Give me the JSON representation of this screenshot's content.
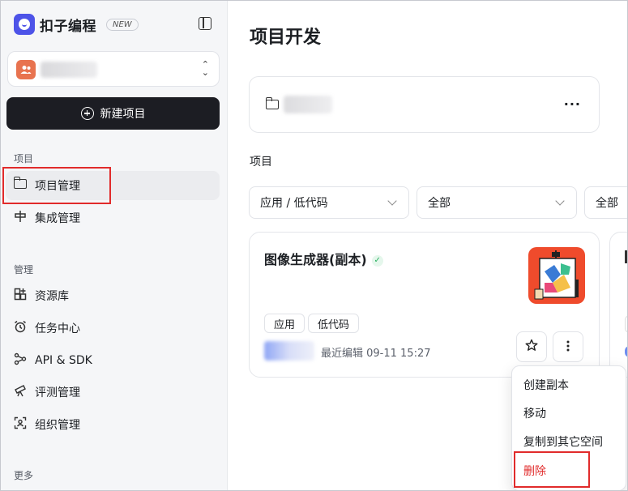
{
  "brand": {
    "name": "扣子编程",
    "badge": "NEW"
  },
  "sidebar": {
    "new_project_label": "新建项目",
    "sections": [
      {
        "label": "项目",
        "items": [
          "项目管理",
          "集成管理"
        ]
      },
      {
        "label": "管理",
        "items": [
          "资源库",
          "任务中心",
          "API & SDK",
          "评测管理",
          "组织管理"
        ]
      },
      {
        "label": "更多",
        "items": []
      }
    ]
  },
  "main": {
    "title": "项目开发",
    "section_title": "项目",
    "filters": [
      "应用 / 低代码",
      "全部",
      "全部"
    ],
    "folder_more": "···",
    "card": {
      "title": "图像生成器(副本)",
      "tags": [
        "应用",
        "低代码"
      ],
      "edit_time": "最近编辑 09-11 15:27"
    },
    "menu": [
      "创建副本",
      "移动",
      "复制到其它空间",
      "删除"
    ]
  },
  "colors": {
    "accent": "#4d53e8",
    "danger": "#e12b2b",
    "thumb": "#ef4b2c"
  }
}
